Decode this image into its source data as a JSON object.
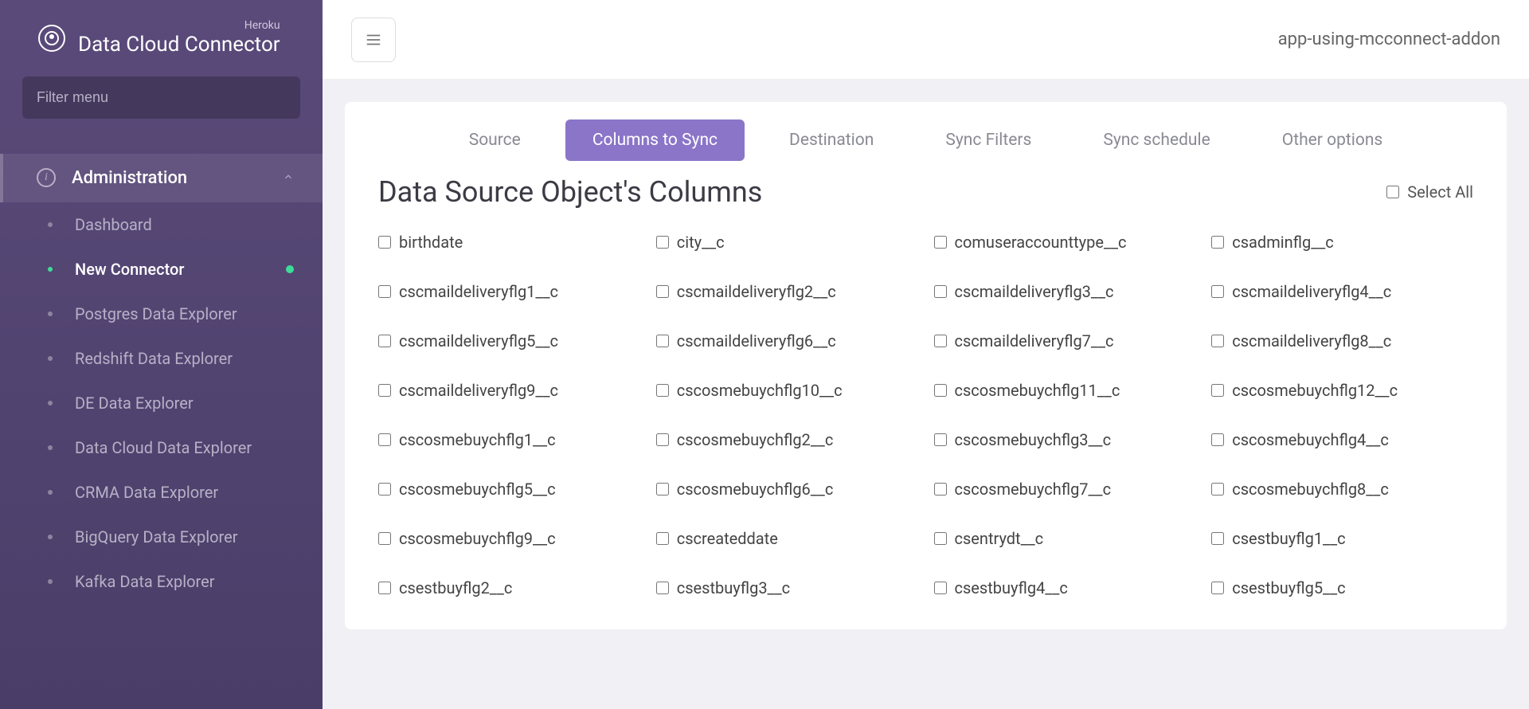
{
  "brand": {
    "sub": "Heroku",
    "title": "Data Cloud Connector"
  },
  "filter": {
    "placeholder": "Filter menu"
  },
  "navHeader": {
    "label": "Administration"
  },
  "navItems": [
    {
      "label": "Dashboard",
      "active": false,
      "indicator": false
    },
    {
      "label": "New Connector",
      "active": true,
      "indicator": true
    },
    {
      "label": "Postgres Data Explorer",
      "active": false,
      "indicator": false
    },
    {
      "label": "Redshift Data Explorer",
      "active": false,
      "indicator": false
    },
    {
      "label": "DE Data Explorer",
      "active": false,
      "indicator": false
    },
    {
      "label": "Data Cloud Data Explorer",
      "active": false,
      "indicator": false
    },
    {
      "label": "CRMA Data Explorer",
      "active": false,
      "indicator": false
    },
    {
      "label": "BigQuery Data Explorer",
      "active": false,
      "indicator": false
    },
    {
      "label": "Kafka Data Explorer",
      "active": false,
      "indicator": false
    }
  ],
  "topbar": {
    "appName": "app-using-mcconnect-addon"
  },
  "tabs": [
    {
      "label": "Source",
      "active": false
    },
    {
      "label": "Columns to Sync",
      "active": true
    },
    {
      "label": "Destination",
      "active": false
    },
    {
      "label": "Sync Filters",
      "active": false
    },
    {
      "label": "Sync schedule",
      "active": false
    },
    {
      "label": "Other options",
      "active": false
    }
  ],
  "section": {
    "title": "Data Source Object's Columns",
    "selectAll": "Select All"
  },
  "columns": [
    "birthdate",
    "city__c",
    "comuseraccounttype__c",
    "csadminflg__c",
    "cscmaildeliveryflg1__c",
    "cscmaildeliveryflg2__c",
    "cscmaildeliveryflg3__c",
    "cscmaildeliveryflg4__c",
    "cscmaildeliveryflg5__c",
    "cscmaildeliveryflg6__c",
    "cscmaildeliveryflg7__c",
    "cscmaildeliveryflg8__c",
    "cscmaildeliveryflg9__c",
    "cscosmebuychflg10__c",
    "cscosmebuychflg11__c",
    "cscosmebuychflg12__c",
    "cscosmebuychflg1__c",
    "cscosmebuychflg2__c",
    "cscosmebuychflg3__c",
    "cscosmebuychflg4__c",
    "cscosmebuychflg5__c",
    "cscosmebuychflg6__c",
    "cscosmebuychflg7__c",
    "cscosmebuychflg8__c",
    "cscosmebuychflg9__c",
    "cscreateddate",
    "csentrydt__c",
    "csestbuyflg1__c",
    "csestbuyflg2__c",
    "csestbuyflg3__c",
    "csestbuyflg4__c",
    "csestbuyflg5__c"
  ]
}
